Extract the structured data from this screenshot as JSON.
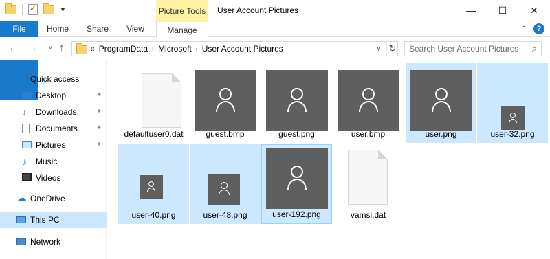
{
  "window": {
    "title": "User Account Pictures",
    "contextual_group": "Picture Tools",
    "controls": {
      "minimize": "—",
      "maximize": "☐",
      "close": "✕"
    }
  },
  "ribbon": {
    "tabs": [
      "File",
      "Home",
      "Share",
      "View",
      "Manage"
    ],
    "collapse_glyph": "⌃",
    "help_glyph": "?"
  },
  "navigation": {
    "back": "←",
    "forward": "→",
    "recent": "∨",
    "up": "↑",
    "breadcrumb_prefix": "«",
    "breadcrumbs": [
      "ProgramData",
      "Microsoft",
      "User Account Pictures"
    ],
    "crumb_separator": "›",
    "dropdown": "∨",
    "refresh": "↻"
  },
  "search": {
    "placeholder": "Search User Account Pictures",
    "icon": "⌕"
  },
  "sidebar": {
    "pin_glyph": "📌",
    "items": [
      {
        "label": "Quick access",
        "icon": "star-icon",
        "pinned": false
      },
      {
        "label": "Desktop",
        "icon": "desktop-icon",
        "pinned": true
      },
      {
        "label": "Downloads",
        "icon": "download-icon",
        "pinned": true
      },
      {
        "label": "Documents",
        "icon": "documents-icon",
        "pinned": true
      },
      {
        "label": "Pictures",
        "icon": "pictures-icon",
        "pinned": true
      },
      {
        "label": "Music",
        "icon": "music-icon",
        "pinned": false
      },
      {
        "label": "Videos",
        "icon": "videos-icon",
        "pinned": false
      },
      {
        "label": "OneDrive",
        "icon": "onedrive-icon",
        "pinned": false
      },
      {
        "label": "This PC",
        "icon": "this-pc-icon",
        "pinned": false,
        "selected": true
      },
      {
        "label": "Network",
        "icon": "network-icon",
        "pinned": false
      }
    ]
  },
  "files": [
    {
      "name": "defaultuser0.dat",
      "thumbnail": "blank-document",
      "selected": false
    },
    {
      "name": "guest.bmp",
      "thumbnail": "user-picture-large",
      "selected": false
    },
    {
      "name": "guest.png",
      "thumbnail": "user-picture-large",
      "selected": false
    },
    {
      "name": "user.bmp",
      "thumbnail": "user-picture-large",
      "selected": false
    },
    {
      "name": "user.png",
      "thumbnail": "user-picture-large",
      "selected": true
    },
    {
      "name": "user-32.png",
      "thumbnail": "user-picture-small",
      "selected": true
    },
    {
      "name": "user-40.png",
      "thumbnail": "user-picture-small",
      "selected": true
    },
    {
      "name": "user-48.png",
      "thumbnail": "user-picture-small",
      "selected": true
    },
    {
      "name": "user-192.png",
      "thumbnail": "user-picture-large",
      "selected": true,
      "focused": true
    },
    {
      "name": "vamsi.dat",
      "thumbnail": "blank-document",
      "selected": false
    }
  ],
  "colors": {
    "file_tab": "#1979ca",
    "contextual_tab": "#fdf3a2",
    "selection": "#cce8ff",
    "selection_border": "#99d1ff",
    "thumbnail_bg": "#5f5f5f"
  }
}
